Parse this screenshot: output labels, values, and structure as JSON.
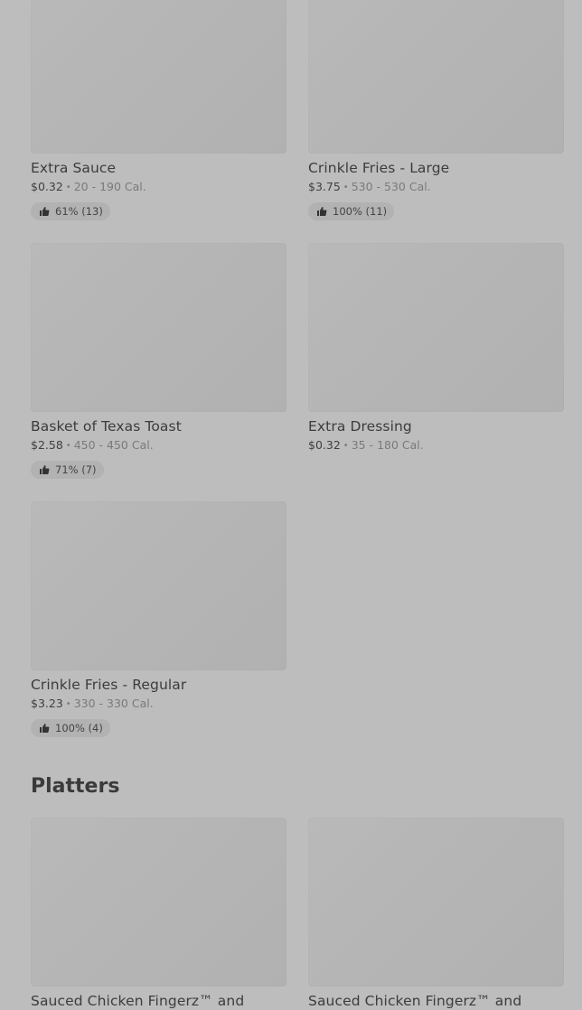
{
  "items": [
    {
      "name": "Extra Sauce",
      "price": "$0.32",
      "calories": "20 - 190 Cal.",
      "rating": "61% (13)"
    },
    {
      "name": "Crinkle Fries - Large",
      "price": "$3.75",
      "calories": "530 - 530 Cal.",
      "rating": "100% (11)"
    },
    {
      "name": "Basket of Texas Toast",
      "price": "$2.58",
      "calories": "450 - 450 Cal.",
      "rating": "71% (7)"
    },
    {
      "name": "Extra Dressing",
      "price": "$0.32",
      "calories": "35 - 180 Cal.",
      "rating": null
    },
    {
      "name": "Crinkle Fries - Regular",
      "price": "$3.23",
      "calories": "330 - 330 Cal.",
      "rating": "100% (4)"
    }
  ],
  "separator": "•",
  "platters": {
    "title": "Platters",
    "items": [
      {
        "name": "Sauced Chicken Fingerz™ and"
      },
      {
        "name": "Sauced Chicken Fingerz™ and"
      }
    ]
  },
  "icons": {
    "rating": "thumbs-up-icon"
  },
  "colors": {
    "background": "#bdbdbd",
    "placeholder": "#b5b5b5",
    "badge": "#b2b2b2"
  }
}
